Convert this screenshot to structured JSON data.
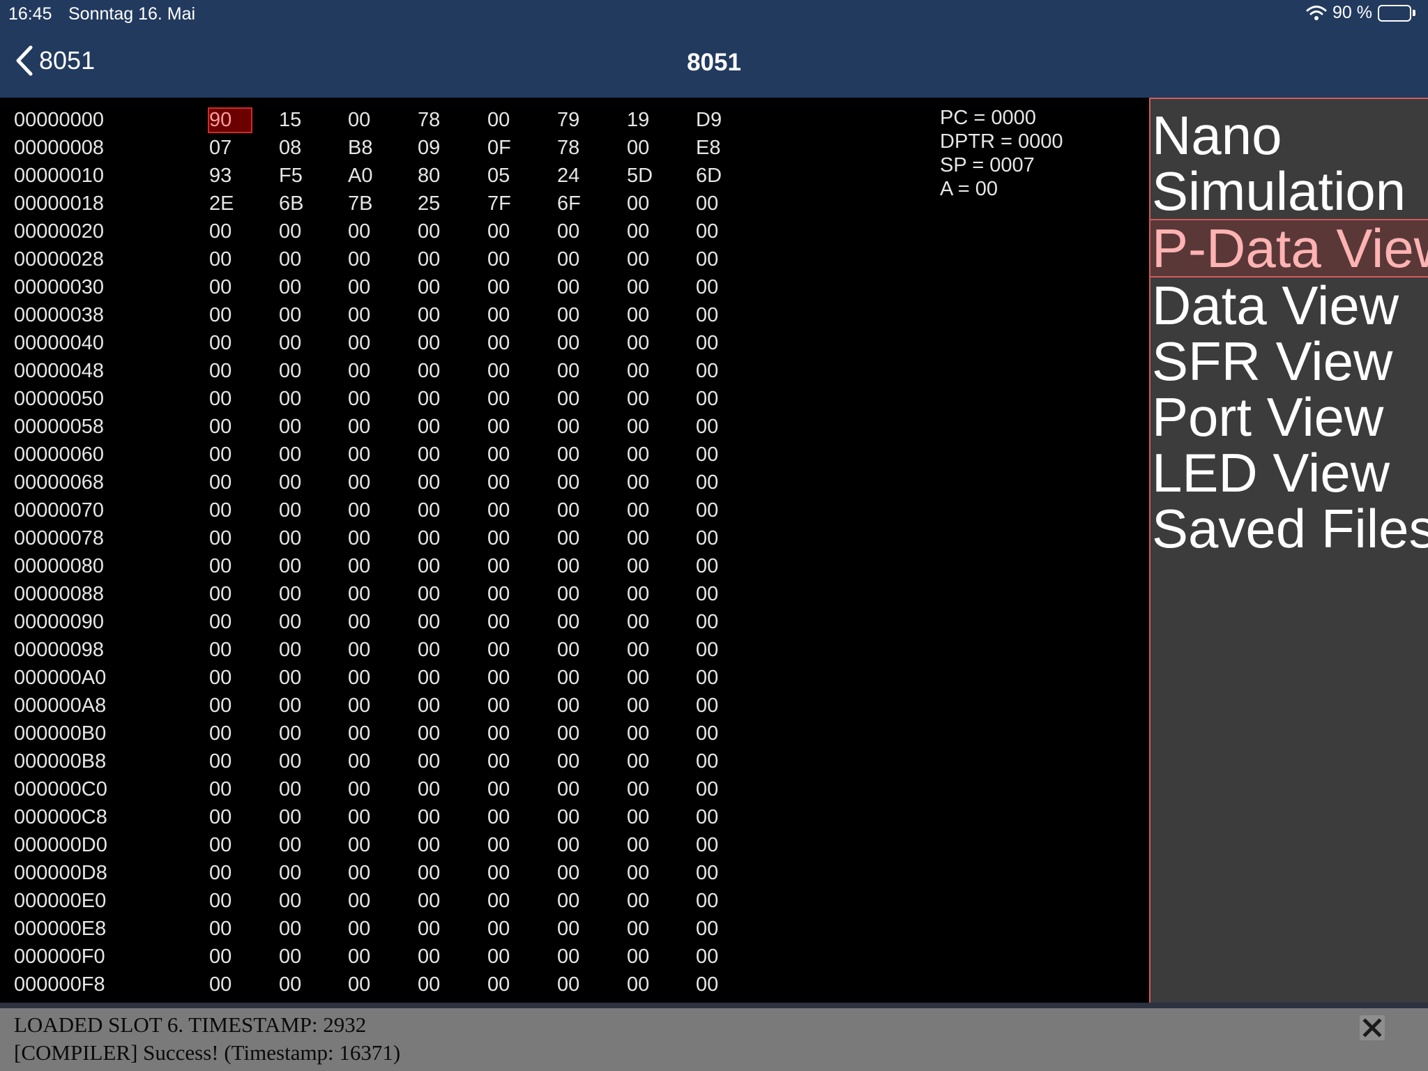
{
  "status_bar": {
    "time": "16:45",
    "date": "Sonntag 16. Mai",
    "battery": "90 %",
    "battery_level": 0.9,
    "icons": [
      "wifi-icon",
      "battery-icon"
    ]
  },
  "nav": {
    "back_label": "8051",
    "title": "8051",
    "back_icon": "chevron-left-icon"
  },
  "memory": {
    "selected": {
      "row": 0,
      "col": 0
    },
    "rows": [
      {
        "addr": "00000000",
        "bytes": [
          "90",
          "15",
          "00",
          "78",
          "00",
          "79",
          "19",
          "D9"
        ]
      },
      {
        "addr": "00000008",
        "bytes": [
          "07",
          "08",
          "B8",
          "09",
          "0F",
          "78",
          "00",
          "E8"
        ]
      },
      {
        "addr": "00000010",
        "bytes": [
          "93",
          "F5",
          "A0",
          "80",
          "05",
          "24",
          "5D",
          "6D"
        ]
      },
      {
        "addr": "00000018",
        "bytes": [
          "2E",
          "6B",
          "7B",
          "25",
          "7F",
          "6F",
          "00",
          "00"
        ]
      },
      {
        "addr": "00000020",
        "bytes": [
          "00",
          "00",
          "00",
          "00",
          "00",
          "00",
          "00",
          "00"
        ]
      },
      {
        "addr": "00000028",
        "bytes": [
          "00",
          "00",
          "00",
          "00",
          "00",
          "00",
          "00",
          "00"
        ]
      },
      {
        "addr": "00000030",
        "bytes": [
          "00",
          "00",
          "00",
          "00",
          "00",
          "00",
          "00",
          "00"
        ]
      },
      {
        "addr": "00000038",
        "bytes": [
          "00",
          "00",
          "00",
          "00",
          "00",
          "00",
          "00",
          "00"
        ]
      },
      {
        "addr": "00000040",
        "bytes": [
          "00",
          "00",
          "00",
          "00",
          "00",
          "00",
          "00",
          "00"
        ]
      },
      {
        "addr": "00000048",
        "bytes": [
          "00",
          "00",
          "00",
          "00",
          "00",
          "00",
          "00",
          "00"
        ]
      },
      {
        "addr": "00000050",
        "bytes": [
          "00",
          "00",
          "00",
          "00",
          "00",
          "00",
          "00",
          "00"
        ]
      },
      {
        "addr": "00000058",
        "bytes": [
          "00",
          "00",
          "00",
          "00",
          "00",
          "00",
          "00",
          "00"
        ]
      },
      {
        "addr": "00000060",
        "bytes": [
          "00",
          "00",
          "00",
          "00",
          "00",
          "00",
          "00",
          "00"
        ]
      },
      {
        "addr": "00000068",
        "bytes": [
          "00",
          "00",
          "00",
          "00",
          "00",
          "00",
          "00",
          "00"
        ]
      },
      {
        "addr": "00000070",
        "bytes": [
          "00",
          "00",
          "00",
          "00",
          "00",
          "00",
          "00",
          "00"
        ]
      },
      {
        "addr": "00000078",
        "bytes": [
          "00",
          "00",
          "00",
          "00",
          "00",
          "00",
          "00",
          "00"
        ]
      },
      {
        "addr": "00000080",
        "bytes": [
          "00",
          "00",
          "00",
          "00",
          "00",
          "00",
          "00",
          "00"
        ]
      },
      {
        "addr": "00000088",
        "bytes": [
          "00",
          "00",
          "00",
          "00",
          "00",
          "00",
          "00",
          "00"
        ]
      },
      {
        "addr": "00000090",
        "bytes": [
          "00",
          "00",
          "00",
          "00",
          "00",
          "00",
          "00",
          "00"
        ]
      },
      {
        "addr": "00000098",
        "bytes": [
          "00",
          "00",
          "00",
          "00",
          "00",
          "00",
          "00",
          "00"
        ]
      },
      {
        "addr": "000000A0",
        "bytes": [
          "00",
          "00",
          "00",
          "00",
          "00",
          "00",
          "00",
          "00"
        ]
      },
      {
        "addr": "000000A8",
        "bytes": [
          "00",
          "00",
          "00",
          "00",
          "00",
          "00",
          "00",
          "00"
        ]
      },
      {
        "addr": "000000B0",
        "bytes": [
          "00",
          "00",
          "00",
          "00",
          "00",
          "00",
          "00",
          "00"
        ]
      },
      {
        "addr": "000000B8",
        "bytes": [
          "00",
          "00",
          "00",
          "00",
          "00",
          "00",
          "00",
          "00"
        ]
      },
      {
        "addr": "000000C0",
        "bytes": [
          "00",
          "00",
          "00",
          "00",
          "00",
          "00",
          "00",
          "00"
        ]
      },
      {
        "addr": "000000C8",
        "bytes": [
          "00",
          "00",
          "00",
          "00",
          "00",
          "00",
          "00",
          "00"
        ]
      },
      {
        "addr": "000000D0",
        "bytes": [
          "00",
          "00",
          "00",
          "00",
          "00",
          "00",
          "00",
          "00"
        ]
      },
      {
        "addr": "000000D8",
        "bytes": [
          "00",
          "00",
          "00",
          "00",
          "00",
          "00",
          "00",
          "00"
        ]
      },
      {
        "addr": "000000E0",
        "bytes": [
          "00",
          "00",
          "00",
          "00",
          "00",
          "00",
          "00",
          "00"
        ]
      },
      {
        "addr": "000000E8",
        "bytes": [
          "00",
          "00",
          "00",
          "00",
          "00",
          "00",
          "00",
          "00"
        ]
      },
      {
        "addr": "000000F0",
        "bytes": [
          "00",
          "00",
          "00",
          "00",
          "00",
          "00",
          "00",
          "00"
        ]
      },
      {
        "addr": "000000F8",
        "bytes": [
          "00",
          "00",
          "00",
          "00",
          "00",
          "00",
          "00",
          "00"
        ]
      }
    ]
  },
  "registers": {
    "pc": "PC = 0000",
    "dptr": "DPTR = 0000",
    "sp": "SP = 0007",
    "a": "A = 00"
  },
  "menu": {
    "items": [
      {
        "label": "Nano"
      },
      {
        "label": "Simulation"
      },
      {
        "label": "P-Data View",
        "active": true
      },
      {
        "label": "Data View"
      },
      {
        "label": "SFR View"
      },
      {
        "label": "Port View"
      },
      {
        "label": "LED View"
      },
      {
        "label": "Saved Files"
      }
    ]
  },
  "console": {
    "lines": [
      "LOADED SLOT 6. TIMESTAMP: 2932",
      "[COMPILER] Success! (Timestamp: 16371)"
    ],
    "close_icon": "close-icon"
  },
  "colors": {
    "nav_bg": "#223a5e",
    "menu_bg": "#3c3c3c",
    "accent_red": "#d25a5a",
    "console_bg": "#7a7a7a"
  }
}
